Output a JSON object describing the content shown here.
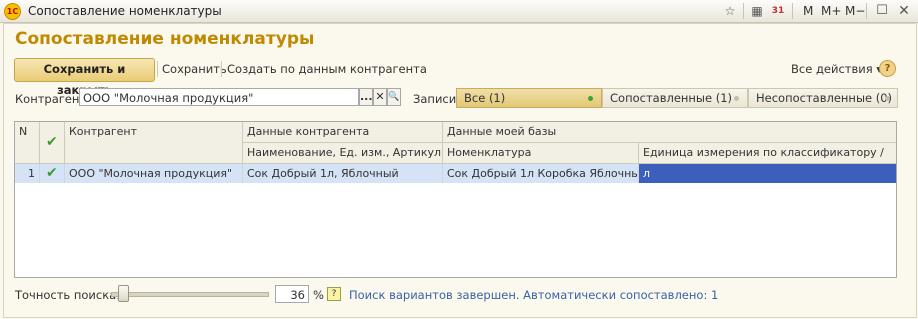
{
  "window": {
    "title": "Сопоставление номенклатуры",
    "app_logo": "1С",
    "controls": {
      "m": "M",
      "m_plus": "M+",
      "m_minus": "M−"
    }
  },
  "form": {
    "title": "Сопоставление номенклатуры",
    "toolbar": {
      "save_close": "Сохранить и закрыть",
      "save": "Сохранить",
      "create_by_data": "Создать по данным контрагента",
      "all_actions": "Все действия ▾",
      "help": "?"
    },
    "counterparty": {
      "label": "Контрагент:",
      "value": "ООО \"Молочная продукция\"",
      "select_btn": "...",
      "clear_btn": "✕",
      "search_btn": "🔍"
    },
    "records": {
      "label": "Записи:",
      "options": [
        {
          "label": "Все (1)",
          "active": true
        },
        {
          "label": "Сопоставленные (1)",
          "active": false
        },
        {
          "label": "Несопоставленные (0)",
          "active": false
        }
      ]
    },
    "table": {
      "headers": {
        "n": "N",
        "counterparty": "Контрагент",
        "cp_data": "Данные контрагента",
        "cp_data_sub": "Наименование, Ед. изм., Артикул,",
        "my_data": "Данные моей базы",
        "nomenclature": "Номенклатура",
        "unit": "Единица измерения по классификатору /"
      },
      "rows": [
        {
          "n": "1",
          "checked": true,
          "counterparty": "ООО \"Молочная продукция\"",
          "cp_data": "Сок Добрый 1л, Яблочный",
          "nomenclature": "Сок Добрый 1л Коробка Яблочный",
          "unit": "л"
        }
      ]
    },
    "bottom": {
      "accuracy_label": "Точность поиска:",
      "accuracy_value": "36",
      "accuracy_fraction": 0.36,
      "percent": "%",
      "hint_icon": "?",
      "status": "Поиск вариантов завершен. Автоматически сопоставлено: 1"
    }
  },
  "colors": {
    "accent_title": "#c08a00",
    "selected_row": "#d5e3f6",
    "selected_cell": "#3b5fba",
    "status_text": "#3863a6"
  }
}
